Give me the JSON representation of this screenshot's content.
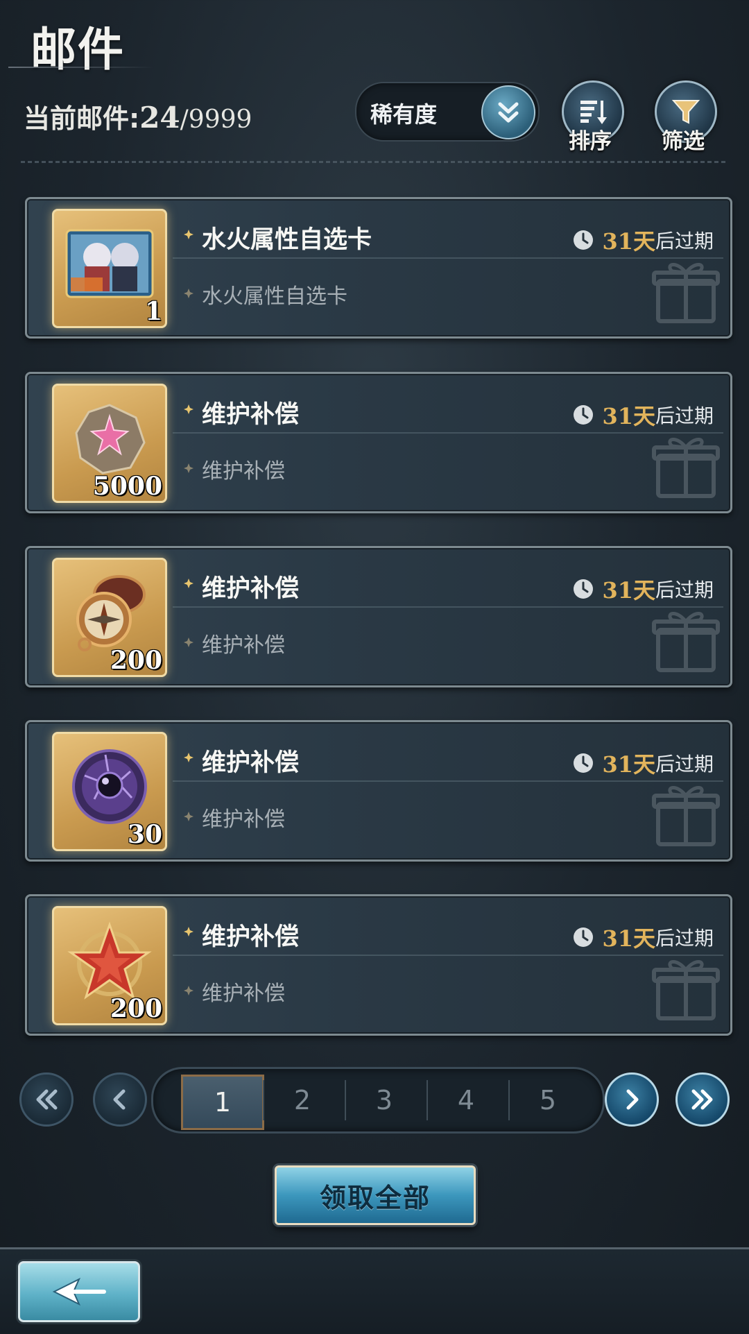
{
  "header": {
    "title": "邮件",
    "mail_count_label": "当前邮件:",
    "mail_count_current": "24",
    "mail_count_max": "/9999"
  },
  "controls": {
    "rarity_label": "稀有度",
    "sort_label": "排序",
    "filter_label": "筛选"
  },
  "mails": [
    {
      "title": "水火属性自选卡",
      "subtitle": "水火属性自选卡",
      "qty": "1",
      "expire_days": "31天",
      "expire_suffix": "后过期",
      "icon": "character-card-icon"
    },
    {
      "title": "维护补偿",
      "subtitle": "维护补偿",
      "qty": "5000",
      "expire_days": "31天",
      "expire_suffix": "后过期",
      "icon": "star-stone-icon"
    },
    {
      "title": "维护补偿",
      "subtitle": "维护补偿",
      "qty": "200",
      "expire_days": "31天",
      "expire_suffix": "后过期",
      "icon": "compass-icon"
    },
    {
      "title": "维护补偿",
      "subtitle": "维护补偿",
      "qty": "30",
      "expire_days": "31天",
      "expire_suffix": "后过期",
      "icon": "dark-orb-icon"
    },
    {
      "title": "维护补偿",
      "subtitle": "维护补偿",
      "qty": "200",
      "expire_days": "31天",
      "expire_suffix": "后过期",
      "icon": "red-star-emblem-icon"
    }
  ],
  "pagination": {
    "pages": [
      "1",
      "2",
      "3",
      "4",
      "5"
    ],
    "current": "1"
  },
  "actions": {
    "claim_all_label": "领取全部"
  },
  "colors": {
    "accent_gold": "#e2b45c",
    "item_frame": "#d7aa60",
    "button_blue": "#3c97bd"
  }
}
